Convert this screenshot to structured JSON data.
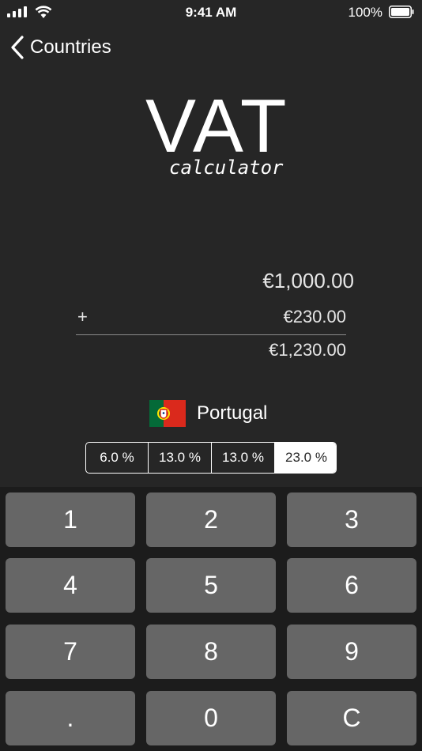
{
  "status_bar": {
    "time": "9:41 AM",
    "battery_percent": "100%",
    "signal_icon": "cellular-signal-icon",
    "wifi_icon": "wifi-icon",
    "battery_icon": "battery-icon"
  },
  "nav": {
    "back_label": "Countries",
    "back_icon": "chevron-left-icon"
  },
  "logo": {
    "title": "VAT",
    "subtitle": "calculator"
  },
  "amounts": {
    "net": "€1,000.00",
    "operator": "+",
    "vat": "€230.00",
    "total": "€1,230.00"
  },
  "country": {
    "name": "Portugal",
    "flag_icon": "portugal-flag-icon",
    "flag_colors": {
      "green": "#046a38",
      "red": "#da291c",
      "yellow": "#ffe900"
    }
  },
  "rates": {
    "options": [
      "6.0 %",
      "13.0 %",
      "13.0 %",
      "23.0 %"
    ],
    "selected_index": 3
  },
  "keypad": {
    "keys": [
      "1",
      "2",
      "3",
      "4",
      "5",
      "6",
      "7",
      "8",
      "9",
      ".",
      "0",
      "C"
    ]
  },
  "colors": {
    "background": "#262626",
    "keypad_background": "#1c1c1c",
    "key_background": "#666666",
    "text": "#ffffff"
  }
}
